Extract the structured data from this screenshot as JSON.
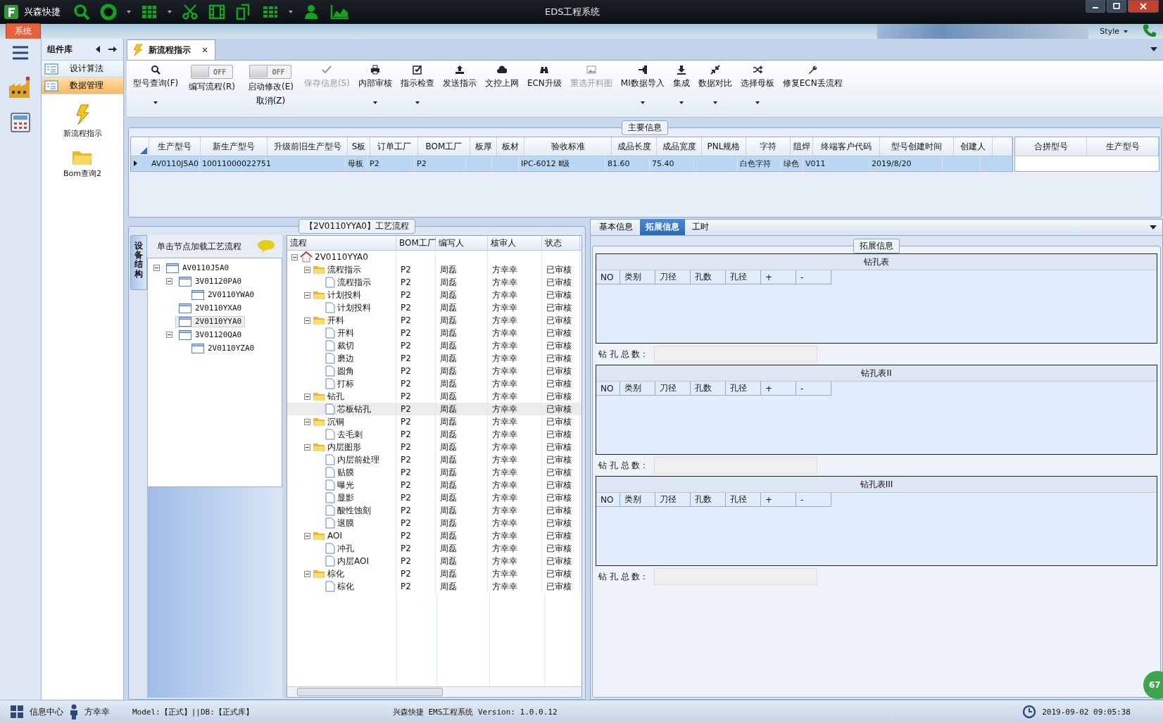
{
  "window": {
    "app_name": "兴森快捷",
    "title": "EDS工程系统"
  },
  "ribbon": {
    "tab": "系统",
    "style_label": "Style"
  },
  "component_library": {
    "title": "组件库",
    "items": [
      {
        "label": "设计算法",
        "selected": false
      },
      {
        "label": "数据管理",
        "selected": true
      }
    ],
    "tools": [
      {
        "label": "新流程指示"
      },
      {
        "label": "Bom查询2"
      }
    ]
  },
  "document_tab": {
    "label": "新流程指示"
  },
  "toolbar": [
    {
      "kind": "button",
      "label": "型号查询(F)",
      "dropdown": true,
      "disabled": false
    },
    {
      "kind": "toggle",
      "label": "编写流程(R)",
      "switch_text": "OFF",
      "on": false
    },
    {
      "kind": "toggle",
      "label": "启动修改(E)",
      "sub_label": "取消(Z)",
      "switch_text": "OFF",
      "on": false
    },
    {
      "kind": "button",
      "label": "保存信息(S)",
      "dropdown": false,
      "disabled": true
    },
    {
      "kind": "button",
      "label": "内部审核",
      "dropdown": true,
      "disabled": false
    },
    {
      "kind": "button",
      "label": "指示检查",
      "dropdown": true,
      "disabled": false
    },
    {
      "kind": "button",
      "label": "发送指示",
      "dropdown": false,
      "disabled": false
    },
    {
      "kind": "button",
      "label": "文控上网",
      "dropdown": false,
      "disabled": false
    },
    {
      "kind": "button",
      "label": "ECN升级",
      "dropdown": false,
      "disabled": false
    },
    {
      "kind": "button",
      "label": "重选开料图",
      "dropdown": false,
      "disabled": true
    },
    {
      "kind": "button",
      "label": "MI数据导入",
      "dropdown": true,
      "disabled": false
    },
    {
      "kind": "button",
      "label": "集成",
      "dropdown": true,
      "disabled": false
    },
    {
      "kind": "button",
      "label": "数据对比",
      "dropdown": true,
      "disabled": false
    },
    {
      "kind": "button",
      "label": "选择母板",
      "dropdown": true,
      "disabled": false
    },
    {
      "kind": "button",
      "label": "修复ECN丢流程",
      "dropdown": false,
      "disabled": false
    }
  ],
  "main_info": {
    "title": "主要信息",
    "columns": [
      "生产型号",
      "新生产型号",
      "升级前旧生产型号",
      "S板",
      "订单工厂",
      "BOM工厂",
      "板厚",
      "板材",
      "验收标准",
      "成品长度",
      "成品宽度",
      "PNL规格",
      "字符",
      "阻焊",
      "终端客户代码",
      "型号创建时间",
      "创建人"
    ],
    "rows": [
      {
        "selected": true,
        "cells": [
          "AV0110J5A0",
          "10011000022751",
          null,
          "母板",
          "P2",
          "P2",
          null,
          null,
          "IPC-6012 Ⅱ级",
          "81.60",
          "75.40",
          null,
          "白色字符",
          "绿色",
          "V011",
          "2019/8/20",
          null
        ]
      }
    ],
    "side_columns": [
      "合拼型号",
      "生产型号"
    ]
  },
  "equipment_tree": {
    "side_tab": "设备结构",
    "hint": "单击节点加载工艺流程",
    "nodes": [
      {
        "label": "AV0110J5A0",
        "expanded": true,
        "selected": false,
        "children": [
          {
            "label": "3V01120PA0",
            "expanded": true,
            "selected": false,
            "children": [
              {
                "label": "2V0110YWA0",
                "selected": false
              }
            ]
          },
          {
            "label": "2V0110YXA0",
            "selected": false
          },
          {
            "label": "2V0110YYA0",
            "selected": true
          },
          {
            "label": "3V01120QA0",
            "expanded": true,
            "selected": false,
            "children": [
              {
                "label": "2V0110YZA0",
                "selected": false
              }
            ]
          }
        ]
      }
    ]
  },
  "process_flow": {
    "title": "【2V0110YYA0】工艺流程",
    "columns": [
      "流程",
      "BOM工厂",
      "编写人",
      "核审人",
      "状态"
    ],
    "nodes": [
      {
        "label": "2V0110YYA0",
        "expanded": true,
        "selected": false,
        "children": [
          {
            "label": "流程指示",
            "bom_factory": "P2",
            "writer": "周磊",
            "reviewer": "方幸幸",
            "status": "已审核",
            "expanded": true,
            "selected": false,
            "children": [
              {
                "label": "流程指示",
                "bom_factory": "P2",
                "writer": "周磊",
                "reviewer": "方幸幸",
                "status": "已审核",
                "selected": false
              }
            ]
          },
          {
            "label": "计划投料",
            "bom_factory": "P2",
            "writer": "周磊",
            "reviewer": "方幸幸",
            "status": "已审核",
            "expanded": true,
            "selected": false,
            "children": [
              {
                "label": "计划投料",
                "bom_factory": "P2",
                "writer": "周磊",
                "reviewer": "方幸幸",
                "status": "已审核",
                "selected": false
              }
            ]
          },
          {
            "label": "开料",
            "bom_factory": "P2",
            "writer": "周磊",
            "reviewer": "方幸幸",
            "status": "已审核",
            "expanded": true,
            "selected": false,
            "children": [
              {
                "label": "开料",
                "bom_factory": "P2",
                "writer": "周磊",
                "reviewer": "方幸幸",
                "status": "已审核",
                "selected": false
              },
              {
                "label": "裁切",
                "bom_factory": "P2",
                "writer": "周磊",
                "reviewer": "方幸幸",
                "status": "已审核",
                "selected": false
              },
              {
                "label": "磨边",
                "bom_factory": "P2",
                "writer": "周磊",
                "reviewer": "方幸幸",
                "status": "已审核",
                "selected": false
              },
              {
                "label": "圆角",
                "bom_factory": "P2",
                "writer": "周磊",
                "reviewer": "方幸幸",
                "status": "已审核",
                "selected": false
              },
              {
                "label": "打标",
                "bom_factory": "P2",
                "writer": "周磊",
                "reviewer": "方幸幸",
                "status": "已审核",
                "selected": false
              }
            ]
          },
          {
            "label": "钻孔",
            "bom_factory": "P2",
            "writer": "周磊",
            "reviewer": "方幸幸",
            "status": "已审核",
            "expanded": true,
            "selected": false,
            "children": [
              {
                "label": "芯板钻孔",
                "bom_factory": "P2",
                "writer": "周磊",
                "reviewer": "方幸幸",
                "status": "已审核",
                "selected": true
              }
            ]
          },
          {
            "label": "沉铜",
            "bom_factory": "P2",
            "writer": "周磊",
            "reviewer": "方幸幸",
            "status": "已审核",
            "expanded": true,
            "selected": false,
            "children": [
              {
                "label": "去毛刺",
                "bom_factory": "P2",
                "writer": "周磊",
                "reviewer": "方幸幸",
                "status": "已审核",
                "selected": false
              }
            ]
          },
          {
            "label": "内层图形",
            "bom_factory": "P2",
            "writer": "周磊",
            "reviewer": "方幸幸",
            "status": "已审核",
            "expanded": true,
            "selected": false,
            "children": [
              {
                "label": "内层前处理",
                "bom_factory": "P2",
                "writer": "周磊",
                "reviewer": "方幸幸",
                "status": "已审核",
                "selected": false
              },
              {
                "label": "贴膜",
                "bom_factory": "P2",
                "writer": "周磊",
                "reviewer": "方幸幸",
                "status": "已审核",
                "selected": false
              },
              {
                "label": "曝光",
                "bom_factory": "P2",
                "writer": "周磊",
                "reviewer": "方幸幸",
                "status": "已审核",
                "selected": false
              },
              {
                "label": "显影",
                "bom_factory": "P2",
                "writer": "周磊",
                "reviewer": "方幸幸",
                "status": "已审核",
                "selected": false
              },
              {
                "label": "酸性蚀刻",
                "bom_factory": "P2",
                "writer": "周磊",
                "reviewer": "方幸幸",
                "status": "已审核",
                "selected": false
              },
              {
                "label": "退膜",
                "bom_factory": "P2",
                "writer": "周磊",
                "reviewer": "方幸幸",
                "status": "已审核",
                "selected": false
              }
            ]
          },
          {
            "label": "AOI",
            "bom_factory": "P2",
            "writer": "周磊",
            "reviewer": "方幸幸",
            "status": "已审核",
            "expanded": true,
            "selected": false,
            "children": [
              {
                "label": "冲孔",
                "bom_factory": "P2",
                "writer": "周磊",
                "reviewer": "方幸幸",
                "status": "已审核",
                "selected": false
              },
              {
                "label": "内层AOI",
                "bom_factory": "P2",
                "writer": "周磊",
                "reviewer": "方幸幸",
                "status": "已审核",
                "selected": false
              }
            ]
          },
          {
            "label": "棕化",
            "bom_factory": "P2",
            "writer": "周磊",
            "reviewer": "方幸幸",
            "status": "已审核",
            "expanded": true,
            "selected": false,
            "children": [
              {
                "label": "棕化",
                "bom_factory": "P2",
                "writer": "周磊",
                "reviewer": "方幸幸",
                "status": "已审核",
                "selected": false
              }
            ]
          }
        ]
      }
    ]
  },
  "detail_tabs": [
    {
      "label": "基本信息",
      "selected": false
    },
    {
      "label": "拓展信息",
      "selected": true
    },
    {
      "label": "工时",
      "selected": false
    }
  ],
  "extended_info": {
    "title": "拓展信息",
    "tables": [
      {
        "title": "钻孔表",
        "columns": [
          "NO",
          "类别",
          "刀径",
          "孔数",
          "孔径",
          "+",
          "-"
        ],
        "total_label": "钻 孔 总 数："
      },
      {
        "title": "钻孔表II",
        "columns": [
          "NO",
          "类别",
          "刀径",
          "孔数",
          "孔径",
          "+",
          "-"
        ],
        "total_label": "钻 孔 总 数："
      },
      {
        "title": "钻孔表III",
        "columns": [
          "NO",
          "类别",
          "刀径",
          "孔数",
          "孔径",
          "+",
          "-"
        ],
        "total_label": "钻 孔 总 数："
      }
    ]
  },
  "status_bar": {
    "info_center": "信息中心",
    "user": "方幸幸",
    "db_info": "Model:【正式】||DB:【正式库】",
    "version": "兴森快捷 EMS工程系统 Version: 1.0.0.12",
    "datetime": "2019-09-02 09:05:38",
    "badge": "67"
  }
}
